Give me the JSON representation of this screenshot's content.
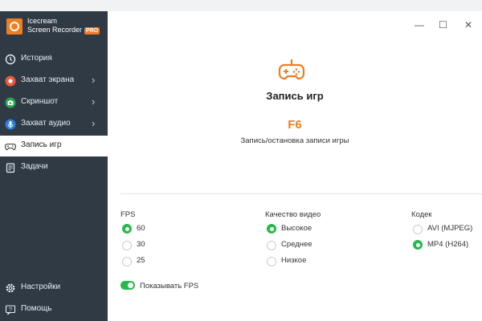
{
  "app": {
    "name_line1": "Icecream",
    "name_line2": "Screen Recorder",
    "badge": "PRO"
  },
  "sidebar": {
    "items": [
      {
        "label": "История",
        "icon": "clock-icon"
      },
      {
        "label": "Захват экрана",
        "icon": "record-icon"
      },
      {
        "label": "Скриншот",
        "icon": "camera-icon"
      },
      {
        "label": "Захват аудио",
        "icon": "microphone-icon"
      },
      {
        "label": "Запись игр",
        "icon": "gamepad-icon",
        "active": true
      },
      {
        "label": "Задачи",
        "icon": "tasks-icon"
      }
    ],
    "bottom": [
      {
        "label": "Настройки",
        "icon": "gear-icon"
      },
      {
        "label": "Помощь",
        "icon": "help-icon"
      }
    ]
  },
  "window_controls": {
    "minimize": "—",
    "maximize": "☐",
    "close": "✕"
  },
  "main": {
    "title": "Запись игр",
    "hotkey": "F6",
    "hotkey_desc": "Запись/остановка записи игры"
  },
  "fps": {
    "label": "FPS",
    "options": [
      "60",
      "30",
      "25"
    ],
    "selected": "60"
  },
  "quality": {
    "label": "Качество видео",
    "options": [
      "Высокое",
      "Среднее",
      "Низкое"
    ],
    "selected": "Высокое"
  },
  "codec": {
    "label": "Кодек",
    "options": [
      "AVI (MJPEG)",
      "MP4 (H264)"
    ],
    "selected": "MP4 (H264)"
  },
  "show_fps": {
    "label": "Показывать FPS",
    "enabled": true
  },
  "colors": {
    "accent": "#ef7d22",
    "sidebar": "#2f3a45",
    "green": "#2ab84d"
  }
}
